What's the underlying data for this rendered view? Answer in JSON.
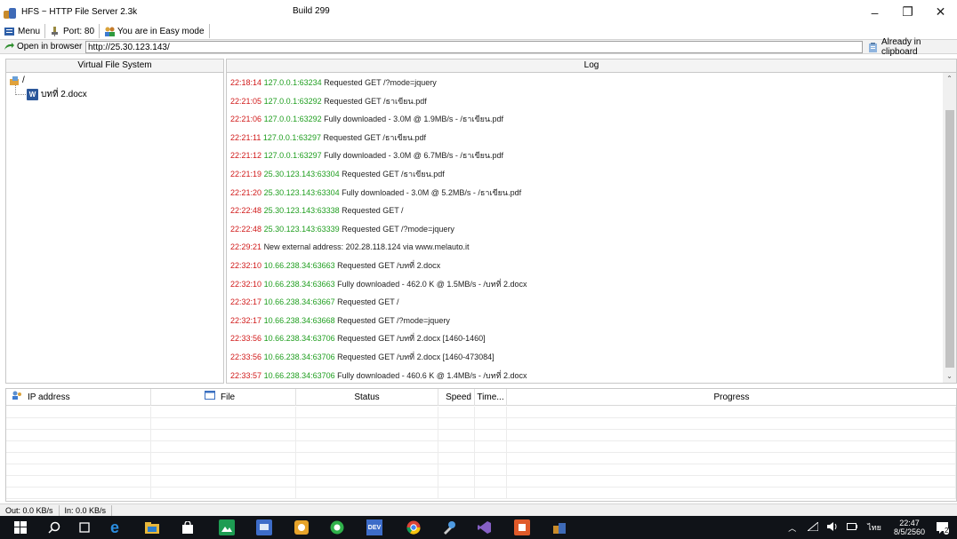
{
  "window": {
    "title": "HFS ~ HTTP File Server 2.3k",
    "build": "Build 299",
    "minimize_glyph": "–",
    "restore_glyph": "❐",
    "close_glyph": "✕"
  },
  "menubar": {
    "menu_label": "Menu",
    "port_label": "Port: 80",
    "mode_label": "You are in Easy mode"
  },
  "urlbar": {
    "open_label": "Open in browser",
    "url": "http://25.30.123.143/",
    "clipboard_label": "Already in clipboard"
  },
  "vfs": {
    "header": "Virtual File System",
    "root": "/",
    "file": "บทที่ 2.docx",
    "file_icon_letter": "W"
  },
  "log": {
    "header": "Log",
    "lines": [
      {
        "time": "22:18:14",
        "addr": "127.0.0.1:63234",
        "msg": "Requested GET /?mode=jquery"
      },
      {
        "time": "22:21:05",
        "addr": "127.0.0.1:63292",
        "msg": "Requested GET /ธาเขียน.pdf"
      },
      {
        "time": "22:21:06",
        "addr": "127.0.0.1:63292",
        "msg": "Fully downloaded - 3.0M @ 1.9MB/s - /ธาเขียน.pdf"
      },
      {
        "time": "22:21:11",
        "addr": "127.0.0.1:63297",
        "msg": "Requested GET /ธาเขียน.pdf"
      },
      {
        "time": "22:21:12",
        "addr": "127.0.0.1:63297",
        "msg": "Fully downloaded - 3.0M @ 6.7MB/s - /ธาเขียน.pdf"
      },
      {
        "time": "22:21:19",
        "addr": "25.30.123.143:63304",
        "msg": "Requested GET /ธาเขียน.pdf"
      },
      {
        "time": "22:21:20",
        "addr": "25.30.123.143:63304",
        "msg": "Fully downloaded - 3.0M @ 5.2MB/s - /ธาเขียน.pdf"
      },
      {
        "time": "22:22:48",
        "addr": "25.30.123.143:63338",
        "msg": "Requested GET /"
      },
      {
        "time": "22:22:48",
        "addr": "25.30.123.143:63339",
        "msg": "Requested GET /?mode=jquery"
      },
      {
        "time": "22:29:21",
        "addr": "",
        "msg": "New external address: 202.28.118.124 via www.melauto.it"
      },
      {
        "time": "22:32:10",
        "addr": "10.66.238.34:63663",
        "msg": "Requested GET /บทที่ 2.docx"
      },
      {
        "time": "22:32:10",
        "addr": "10.66.238.34:63663",
        "msg": "Fully downloaded - 462.0 K @ 1.5MB/s - /บทที่ 2.docx"
      },
      {
        "time": "22:32:17",
        "addr": "10.66.238.34:63667",
        "msg": "Requested GET /"
      },
      {
        "time": "22:32:17",
        "addr": "10.66.238.34:63668",
        "msg": "Requested GET /?mode=jquery"
      },
      {
        "time": "22:33:56",
        "addr": "10.66.238.34:63706",
        "msg": "Requested GET /บทที่ 2.docx   [1460-1460]"
      },
      {
        "time": "22:33:56",
        "addr": "10.66.238.34:63706",
        "msg": "Requested GET /บทที่ 2.docx   [1460-473084]"
      },
      {
        "time": "22:33:57",
        "addr": "10.66.238.34:63706",
        "msg": "Fully downloaded - 460.6 K @ 1.4MB/s - /บทที่ 2.docx"
      }
    ]
  },
  "connections": {
    "columns": [
      "IP address",
      "File",
      "Status",
      "Speed",
      "Time...",
      "Progress"
    ],
    "rows": 8
  },
  "statusbar": {
    "out": "Out: 0.0 KB/s",
    "in": "In: 0.0 KB/s"
  },
  "taskbar": {
    "lang": "ไทย",
    "time": "22:47",
    "date": "8/5/2560",
    "notification_count": "2"
  },
  "colors": {
    "log_time": "#d11a1a",
    "log_addr": "#1f9e1f",
    "taskbar_bg": "#101318"
  }
}
